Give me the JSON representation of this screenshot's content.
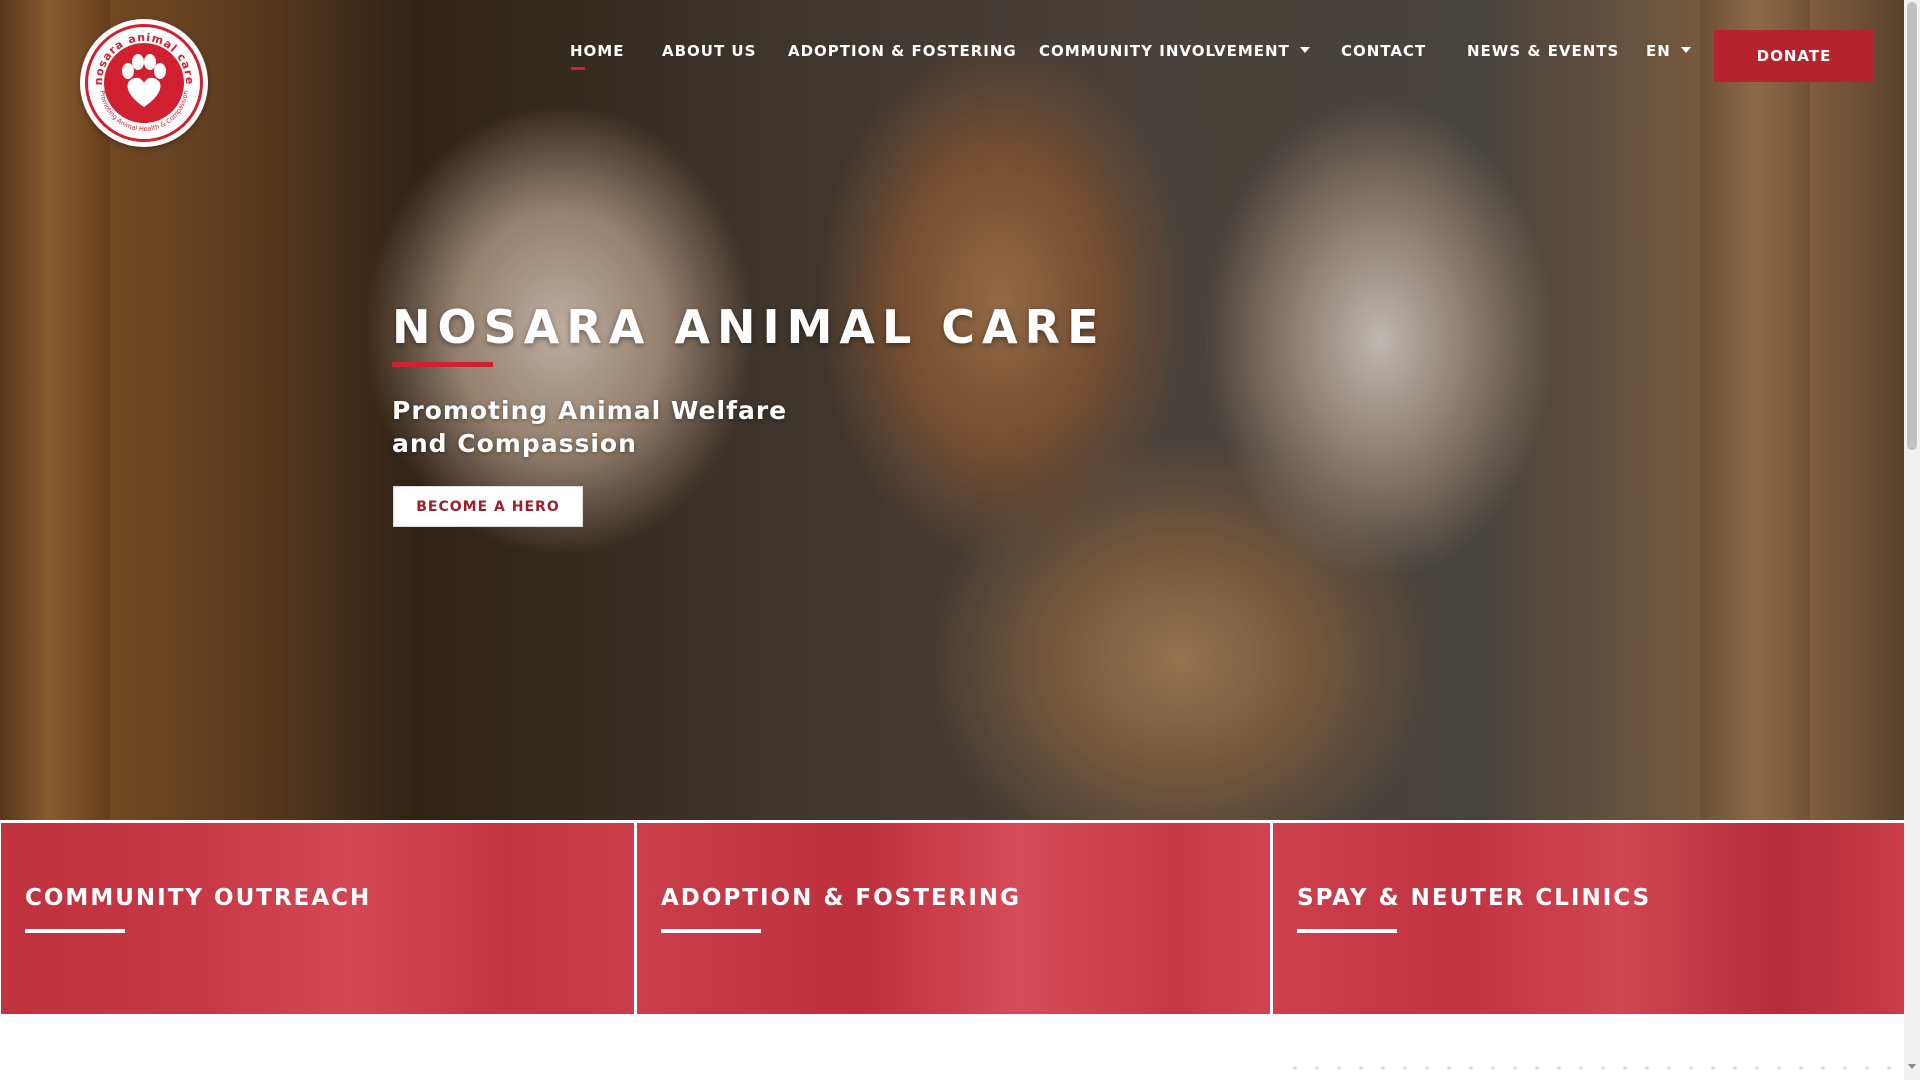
{
  "brand": {
    "name": "Nosara Animal Care",
    "logo_text_top": "nosara animal care",
    "logo_text_bottom": "Promoting Animal Health & Compassion",
    "accent_color": "#d1202f",
    "donate_color": "#b5232f"
  },
  "nav": {
    "items": [
      {
        "label": "HOME",
        "active": true
      },
      {
        "label": "ABOUT US"
      },
      {
        "label": "ADOPTION & FOSTERING"
      },
      {
        "label": "COMMUNITY INVOLVEMENT",
        "has_dropdown": true
      },
      {
        "label": "CONTACT"
      },
      {
        "label": "NEWS & EVENTS"
      },
      {
        "label": "EN",
        "has_dropdown": true
      }
    ],
    "donate_label": "DONATE"
  },
  "hero": {
    "title": "NOSARA ANIMAL CARE",
    "subtitle": "Promoting Animal Welfare and Compassion",
    "cta_label": "BECOME A HERO"
  },
  "features": [
    {
      "title": "COMMUNITY OUTREACH"
    },
    {
      "title": "ADOPTION & FOSTERING"
    },
    {
      "title": "SPAY & NEUTER CLINICS"
    }
  ],
  "icons": {
    "logo": "paw-heart-icon",
    "dropdown": "caret-down-icon"
  }
}
